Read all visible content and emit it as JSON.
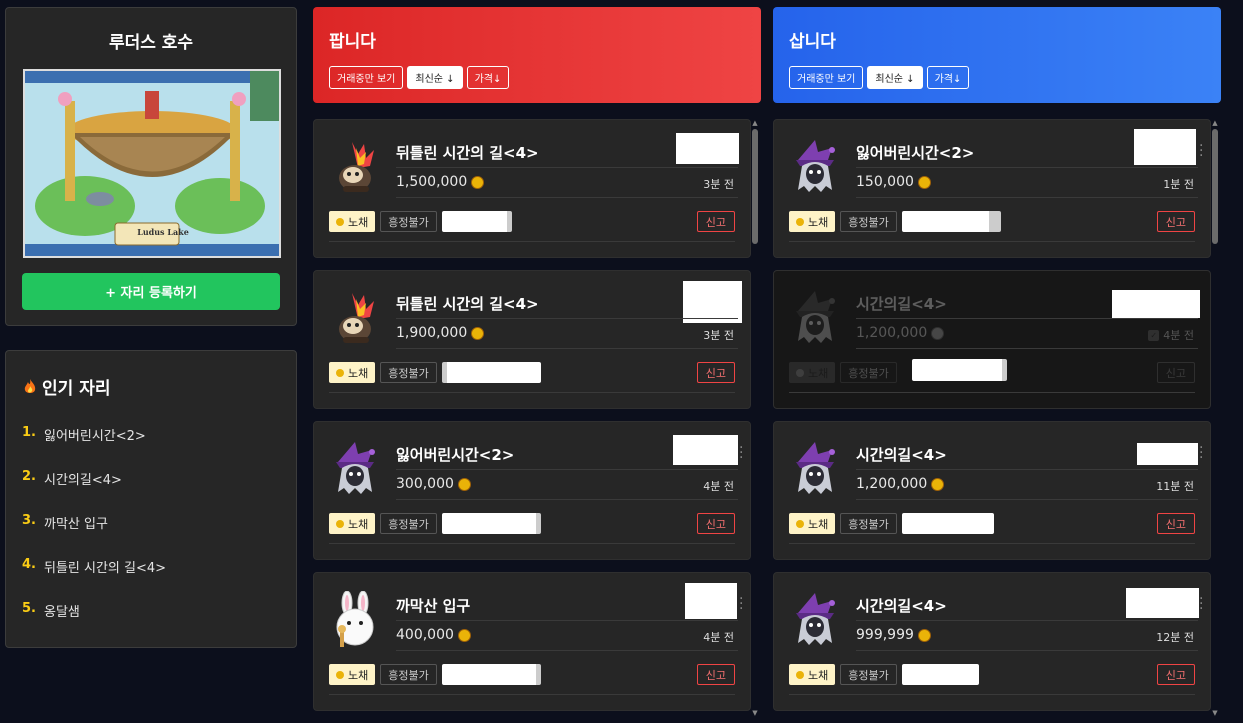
{
  "map": {
    "title": "루더스 호수",
    "image_text": [
      "Ludus Lake"
    ],
    "register_label": "+ 자리 등록하기"
  },
  "popular": {
    "title": "인기 자리",
    "items": [
      {
        "rank": "1.",
        "label": "잃어버린시간<2>"
      },
      {
        "rank": "2.",
        "label": "시간의길<4>"
      },
      {
        "rank": "3.",
        "label": "까막산 입구"
      },
      {
        "rank": "4.",
        "label": "뒤틀린 시간의 길<4>"
      },
      {
        "rank": "5.",
        "label": "옹달샘"
      }
    ]
  },
  "sell": {
    "title": "팝니다",
    "filters": [
      "거래중만 보기",
      "최신순 ↓",
      "가격↓"
    ],
    "listings": [
      {
        "name": "뒤틀린 시간의 길<4>",
        "price": "1,500,000",
        "time": "3분 전",
        "tag": "노채",
        "haggle": "흥정불가",
        "report": "신고",
        "icon": "flame-mask-monster-icon"
      },
      {
        "name": "뒤틀린 시간의 길<4>",
        "price": "1,900,000",
        "time": "3분 전",
        "tag": "노채",
        "haggle": "흥정불가",
        "report": "신고",
        "icon": "flame-mask-monster-icon"
      },
      {
        "name": "잃어버린시간<2>",
        "price": "300,000",
        "time": "4분 전",
        "tag": "노채",
        "haggle": "흥정불가",
        "report": "신고",
        "icon": "purple-hat-ghost-icon"
      },
      {
        "name": "까막산 입구",
        "price": "400,000",
        "time": "4분 전",
        "tag": "노채",
        "haggle": "흥정불가",
        "report": "신고",
        "icon": "white-rabbit-icon"
      }
    ]
  },
  "buy": {
    "title": "삽니다",
    "filters": [
      "거래중만 보기",
      "최신순 ↓",
      "가격↓"
    ],
    "listings": [
      {
        "name": "잃어버린시간<2>",
        "price": "150,000",
        "time": "1분 전",
        "tag": "노채",
        "haggle": "흥정불가",
        "report": "신고",
        "icon": "purple-hat-ghost-icon"
      },
      {
        "name": "시간의길<4>",
        "price": "1,200,000",
        "time": "4분 전",
        "tag": "노채",
        "haggle": "흥정불가",
        "report": "신고",
        "icon": "purple-hat-ghost-icon"
      },
      {
        "name": "시간의길<4>",
        "price": "1,200,000",
        "time": "11분 전",
        "tag": "노채",
        "haggle": "흥정불가",
        "report": "신고",
        "icon": "purple-hat-ghost-icon"
      },
      {
        "name": "시간의길<4>",
        "price": "999,999",
        "time": "12분 전",
        "tag": "노채",
        "haggle": "흥정불가",
        "report": "신고",
        "icon": "purple-hat-ghost-icon"
      }
    ]
  },
  "colors": {
    "sell_accent": "#dc2626",
    "buy_accent": "#2563eb",
    "register_green": "#22c55e",
    "rank_yellow": "#facc15"
  }
}
